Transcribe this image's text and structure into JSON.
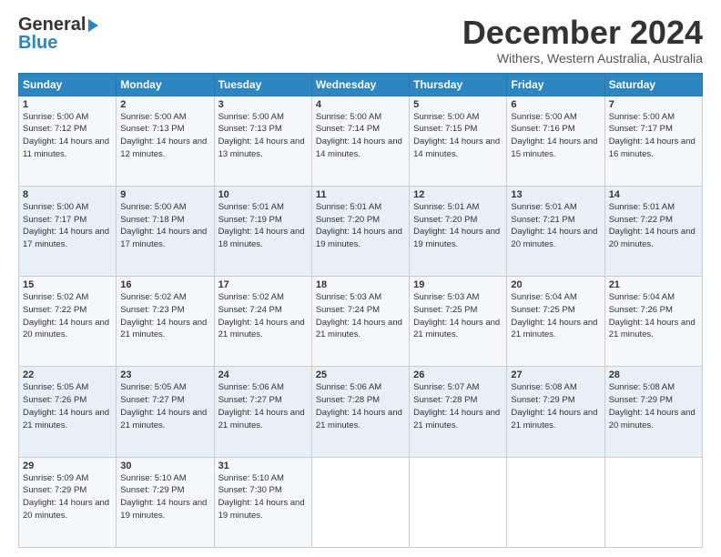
{
  "logo": {
    "line1": "General",
    "line2": "Blue"
  },
  "title": "December 2024",
  "subtitle": "Withers, Western Australia, Australia",
  "days_header": [
    "Sunday",
    "Monday",
    "Tuesday",
    "Wednesday",
    "Thursday",
    "Friday",
    "Saturday"
  ],
  "weeks": [
    [
      {
        "day": "1",
        "sunrise": "5:00 AM",
        "sunset": "7:12 PM",
        "daylight": "14 hours and 11 minutes."
      },
      {
        "day": "2",
        "sunrise": "5:00 AM",
        "sunset": "7:13 PM",
        "daylight": "14 hours and 12 minutes."
      },
      {
        "day": "3",
        "sunrise": "5:00 AM",
        "sunset": "7:13 PM",
        "daylight": "14 hours and 13 minutes."
      },
      {
        "day": "4",
        "sunrise": "5:00 AM",
        "sunset": "7:14 PM",
        "daylight": "14 hours and 14 minutes."
      },
      {
        "day": "5",
        "sunrise": "5:00 AM",
        "sunset": "7:15 PM",
        "daylight": "14 hours and 14 minutes."
      },
      {
        "day": "6",
        "sunrise": "5:00 AM",
        "sunset": "7:16 PM",
        "daylight": "14 hours and 15 minutes."
      },
      {
        "day": "7",
        "sunrise": "5:00 AM",
        "sunset": "7:17 PM",
        "daylight": "14 hours and 16 minutes."
      }
    ],
    [
      {
        "day": "8",
        "sunrise": "5:00 AM",
        "sunset": "7:17 PM",
        "daylight": "14 hours and 17 minutes."
      },
      {
        "day": "9",
        "sunrise": "5:00 AM",
        "sunset": "7:18 PM",
        "daylight": "14 hours and 17 minutes."
      },
      {
        "day": "10",
        "sunrise": "5:01 AM",
        "sunset": "7:19 PM",
        "daylight": "14 hours and 18 minutes."
      },
      {
        "day": "11",
        "sunrise": "5:01 AM",
        "sunset": "7:20 PM",
        "daylight": "14 hours and 19 minutes."
      },
      {
        "day": "12",
        "sunrise": "5:01 AM",
        "sunset": "7:20 PM",
        "daylight": "14 hours and 19 minutes."
      },
      {
        "day": "13",
        "sunrise": "5:01 AM",
        "sunset": "7:21 PM",
        "daylight": "14 hours and 20 minutes."
      },
      {
        "day": "14",
        "sunrise": "5:01 AM",
        "sunset": "7:22 PM",
        "daylight": "14 hours and 20 minutes."
      }
    ],
    [
      {
        "day": "15",
        "sunrise": "5:02 AM",
        "sunset": "7:22 PM",
        "daylight": "14 hours and 20 minutes."
      },
      {
        "day": "16",
        "sunrise": "5:02 AM",
        "sunset": "7:23 PM",
        "daylight": "14 hours and 21 minutes."
      },
      {
        "day": "17",
        "sunrise": "5:02 AM",
        "sunset": "7:24 PM",
        "daylight": "14 hours and 21 minutes."
      },
      {
        "day": "18",
        "sunrise": "5:03 AM",
        "sunset": "7:24 PM",
        "daylight": "14 hours and 21 minutes."
      },
      {
        "day": "19",
        "sunrise": "5:03 AM",
        "sunset": "7:25 PM",
        "daylight": "14 hours and 21 minutes."
      },
      {
        "day": "20",
        "sunrise": "5:04 AM",
        "sunset": "7:25 PM",
        "daylight": "14 hours and 21 minutes."
      },
      {
        "day": "21",
        "sunrise": "5:04 AM",
        "sunset": "7:26 PM",
        "daylight": "14 hours and 21 minutes."
      }
    ],
    [
      {
        "day": "22",
        "sunrise": "5:05 AM",
        "sunset": "7:26 PM",
        "daylight": "14 hours and 21 minutes."
      },
      {
        "day": "23",
        "sunrise": "5:05 AM",
        "sunset": "7:27 PM",
        "daylight": "14 hours and 21 minutes."
      },
      {
        "day": "24",
        "sunrise": "5:06 AM",
        "sunset": "7:27 PM",
        "daylight": "14 hours and 21 minutes."
      },
      {
        "day": "25",
        "sunrise": "5:06 AM",
        "sunset": "7:28 PM",
        "daylight": "14 hours and 21 minutes."
      },
      {
        "day": "26",
        "sunrise": "5:07 AM",
        "sunset": "7:28 PM",
        "daylight": "14 hours and 21 minutes."
      },
      {
        "day": "27",
        "sunrise": "5:08 AM",
        "sunset": "7:29 PM",
        "daylight": "14 hours and 21 minutes."
      },
      {
        "day": "28",
        "sunrise": "5:08 AM",
        "sunset": "7:29 PM",
        "daylight": "14 hours and 20 minutes."
      }
    ],
    [
      {
        "day": "29",
        "sunrise": "5:09 AM",
        "sunset": "7:29 PM",
        "daylight": "14 hours and 20 minutes."
      },
      {
        "day": "30",
        "sunrise": "5:10 AM",
        "sunset": "7:29 PM",
        "daylight": "14 hours and 19 minutes."
      },
      {
        "day": "31",
        "sunrise": "5:10 AM",
        "sunset": "7:30 PM",
        "daylight": "14 hours and 19 minutes."
      },
      null,
      null,
      null,
      null
    ]
  ]
}
